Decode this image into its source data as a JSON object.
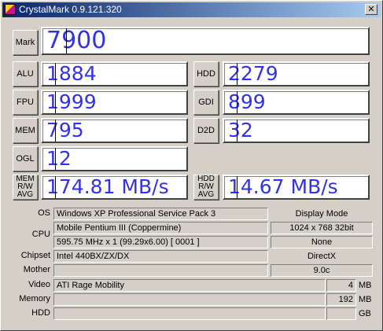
{
  "window": {
    "title": "CrystalMark  0.9.121.320",
    "close_glyph": "✕"
  },
  "scores": {
    "mark": {
      "label": "Mark",
      "value": "7900"
    },
    "alu": {
      "label": "ALU",
      "value": "1884"
    },
    "hdd": {
      "label": "HDD",
      "value": "2279"
    },
    "fpu": {
      "label": "FPU",
      "value": "1999"
    },
    "gdi": {
      "label": "GDI",
      "value": "899"
    },
    "mem": {
      "label": "MEM",
      "value": "795"
    },
    "d2d": {
      "label": "D2D",
      "value": "32"
    },
    "ogl": {
      "label": "OGL",
      "value": "12"
    },
    "mem_rw": {
      "label_lines": [
        "MEM",
        "R/W",
        "AVG"
      ],
      "value": "174.81 MB/s"
    },
    "hdd_rw": {
      "label_lines": [
        "HDD",
        "R/W",
        "AVG"
      ],
      "value": "14.67 MB/s"
    }
  },
  "system": {
    "os_label": "OS",
    "os_value": "Windows XP Professional Service Pack 3",
    "cpu_label": "CPU",
    "cpu_name": "Mobile Pentium III (Coppermine)",
    "cpu_clock": "595.75 MHz x 1 (99.29x6.00) [ 0001 ]",
    "chipset_label": "Chipset",
    "chipset_value": "Intel 440BX/ZX/DX",
    "mother_label": "Mother",
    "mother_value": "",
    "video_label": "Video",
    "video_value": "ATI Rage Mobility",
    "video_mem": "4",
    "video_unit": "MB",
    "memory_label": "Memory",
    "memory_value": "",
    "memory_size": "192",
    "memory_unit": "MB",
    "hdd_label": "HDD",
    "hdd_value": "",
    "hdd_size": "",
    "hdd_unit": "GB",
    "display_mode_label": "Display Mode",
    "display_mode_value": "1024 x 768 32bit",
    "display_extra": "None",
    "directx_label": "DirectX",
    "directx_value": "9.0c"
  },
  "colors": {
    "score_text": "#3232e6",
    "titlebar_start": "#0a246a",
    "titlebar_end": "#a6caf0"
  }
}
